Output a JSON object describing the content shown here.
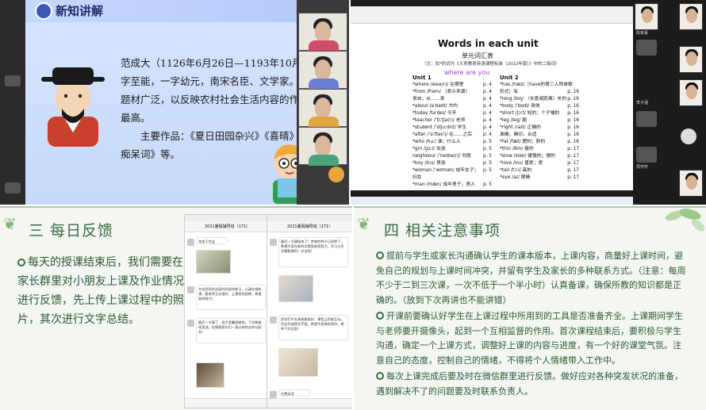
{
  "panel1": {
    "slide_title": "新知讲解",
    "bio_lines": [
      "范成大（1126年6月26日—1193年10月1日",
      "字至能，一字幼元，南宋名臣、文学家。他的",
      "题材广泛，以反映农村社会生活内容的作品成",
      "最高。"
    ],
    "works_lines": [
      "主要作品：《夏日田园杂兴》《喜晴》《卖",
      "痴呆词》等。"
    ]
  },
  "panel2": {
    "title": "Words in each unit",
    "subtitle": "单元词汇表",
    "note": "（注：加*的词为《义务教育英语课程标准（2022年版）》中的二级词）",
    "annotation": "where are you",
    "unit1": {
      "heading": "Unit 1",
      "rows": [
        {
          "w": "*where /weə(r)/ 在哪里",
          "p": "p. 4"
        },
        {
          "w": "*from /frəm/ （表示来源）",
          "p": "p. 4"
        },
        {
          "w": "来自；从……来",
          "p": "p. 4"
        },
        {
          "w": "*about /əˈbaʊt/ 大约",
          "p": "p. 4"
        },
        {
          "w": "*today /təˈdeɪ/ 今天",
          "p": "p. 4"
        },
        {
          "w": "*teacher /ˈtiːtʃə(r)/ 老师",
          "p": "p. 4"
        },
        {
          "w": "*student /ˈstjuːdnt/ 学生",
          "p": "p. 4"
        },
        {
          "w": "*after /ˈɑːftə(r)/ 在……之后",
          "p": "p. 4"
        },
        {
          "w": "*who /huː/ 谁；什么人",
          "p": "p. 5"
        },
        {
          "w": "*girl /ɡɜːl/ 女孩",
          "p": "p. 5"
        },
        {
          "w": "neighbour /ˈneɪbə(r)/ 邻居",
          "p": "p. 5"
        },
        {
          "w": "*boy /bɔɪ/ 男孩",
          "p": "p. 5"
        },
        {
          "w": "*woman /ˈwʊmən/ 成年女子；",
          "p": "p. 5"
        },
        {
          "w": "妇女",
          "p": ""
        },
        {
          "w": "*man /mæn/ 成年男子；男人",
          "p": "p. 5"
        }
      ]
    },
    "unit2": {
      "heading": "Unit 2",
      "rows": [
        {
          "w": "*has /hæz/（have的第三人称单数",
          "p": ""
        },
        {
          "w": "形式）有",
          "p": "p. 16"
        },
        {
          "w": "*long /lɒŋ/ （长度或距离）长的",
          "p": "p. 16"
        },
        {
          "w": "*body /ˈbɒdi/ 身体",
          "p": "p. 16"
        },
        {
          "w": "*short /ʃɔːt/ 短的；个子矮的",
          "p": "p. 16"
        },
        {
          "w": "*leg /leɡ/ 腿",
          "p": "p. 16"
        },
        {
          "w": "*right /raɪt/ 正确的",
          "p": "p. 16"
        },
        {
          "w": "准确，确切，合适",
          "p": "p. 16"
        },
        {
          "w": "*fat /fæt/ 肥的；胖的",
          "p": "p. 16"
        },
        {
          "w": "*thin /θɪn/ 瘦的",
          "p": "p. 17"
        },
        {
          "w": "*slow /sləʊ/ 缓慢的；慢的",
          "p": "p. 17"
        },
        {
          "w": "*love /lʌv/ 喜爱；爱",
          "p": "p. 17"
        },
        {
          "w": "*tall /tɔːl/ 高的",
          "p": "p. 17"
        },
        {
          "w": "*eye /aɪ/ 眼睛",
          "p": "p. 17"
        }
      ]
    },
    "tile_labels": [
      "陈家豪",
      "李子涵",
      "周宇轩"
    ]
  },
  "panel3": {
    "section_title": "三  每日反馈",
    "body": "每天的授课结束后，我们需要在家长群里对小朋友上课及作业情况进行反馈，先上传上课过程中的照片，其次进行文字总结。",
    "phone_header": "2021暑假辅导班（171）",
    "phone_messages_left": [
      "完成下作业",
      "辛苦您同学这段时间坚持练习，认真在线听课，跟老师互动很好，上课表现很棒，希望继续努力！",
      "最后一节课了，祝大家暑假愉快，下学期继续加油，也感谢家长们一直以来的支持与配合！"
    ],
    "phone_messages_right": [
      "最后一节课结束了！梦想的种子已经种下，希望大家在新的学期里继续努力，学习与生活都能顺利！辛苦啦！",
      "同学们今天表现都很好，课堂上积极互动，作业完成得也不错，希望大家继续保持，期待下次见面！"
    ],
    "phone_sender": "众教英语"
  },
  "panel4": {
    "section_title": "四  相关注意事项",
    "notes": [
      "提前与学生或家长沟通确认学生的课本版本，上课内容，商量好上课时间，避免自己的规划与上课时间冲突，并留有学生及家长的多种联系方式。（注意：每周不少于二到三次课，一次不低于一个半小时）认真备课，确保所教的知识都是正确的。（放到下次再讲也不能讲错）",
      "开课前要确认好学生在上课过程中所用到的工具是否准备齐全。上课期间学生与老师要开摄像头，起到一个互相监督的作用。首次课程结束后，要积极与学生沟通，确定一个上课方式，调整好上课的内容与进度，有一个好的课堂气氛。注意自己的态度，控制自己的情绪，不得将个人情绪带入工作中。",
      "每次上课完成后要及时在微信群里进行反馈。做好应对各种突发状况的准备，遇到解决不了的问题要及时联系负责人。"
    ]
  },
  "colors": {
    "green_text": "#2d5a36",
    "leaf": "#86b37a",
    "slide_bg": "#d6e4ff",
    "annotation_purple": "#9b40d8"
  }
}
